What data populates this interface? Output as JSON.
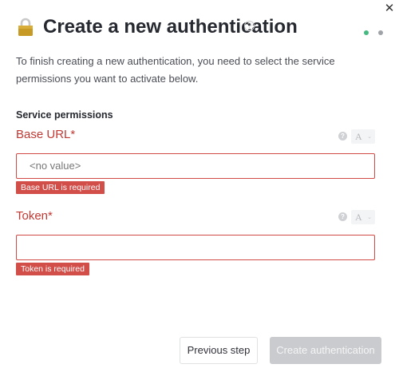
{
  "modal": {
    "title": "Create a new authentication",
    "close_icon": "close-icon",
    "title_help_icon": "help-circle-icon",
    "lock_icon": "lock-icon",
    "intro": "To finish creating a new authentication, you need to select the service permissions you want to activate below.",
    "steps": {
      "count": 2,
      "active_index": 0
    }
  },
  "permissions": {
    "section_title": "Service permissions",
    "fields": [
      {
        "label": "Base URL",
        "required_mark": "*",
        "placeholder": "<no value>",
        "value": "",
        "error": "Base URL is required",
        "tool_help_icon": "help-icon",
        "tool_type_label": "A"
      },
      {
        "label": "Token",
        "required_mark": "*",
        "placeholder": "",
        "value": "",
        "error": "Token is required",
        "tool_help_icon": "help-icon",
        "tool_type_label": "A"
      }
    ]
  },
  "footer": {
    "previous_label": "Previous step",
    "create_label": "Create authentication"
  },
  "colors": {
    "error": "#d14e49",
    "step_active": "#47b881",
    "step_inactive": "#9fa3a8",
    "button_disabled": "#c9cbcf"
  }
}
